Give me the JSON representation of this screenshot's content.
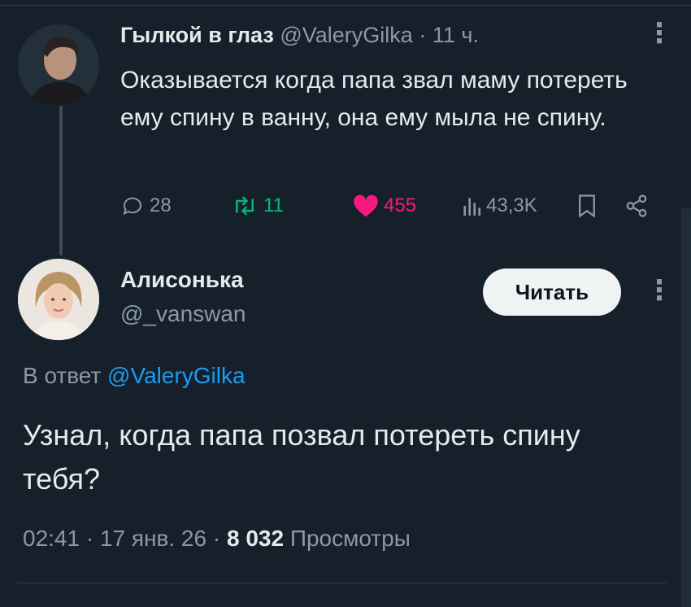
{
  "tweet": {
    "author_name": "Гылкой в глаз",
    "author_handle": "@ValeryGilka",
    "separator": "·",
    "time": "11 ч.",
    "more_icon": "⋮",
    "text": "Оказывается когда папа звал маму потереть ему спину в ванну, она ему мыла не спину.",
    "stats": {
      "replies": "28",
      "retweets": "11",
      "likes": "455",
      "views": "43,3K"
    },
    "icons": [
      "reply-icon",
      "retweet-icon",
      "heart-icon",
      "views-icon",
      "bookmark-icon",
      "share-icon"
    ]
  },
  "reply": {
    "author_name": "Алисонька",
    "author_handle": "@_vanswan",
    "follow_label": "Читать",
    "more_icon": "⋮",
    "reply_to_prefix": "В ответ",
    "reply_to_handle": "@ValeryGilka",
    "text": "Узнал, когда папа позвал потереть спину тебя?",
    "meta_time": "02:41 · 17 янв. 26 ·",
    "meta_views_count": "8 032",
    "meta_views_label": "Просмотры"
  },
  "colors": {
    "background": "#15202b",
    "text_primary": "#e7e9ea",
    "text_secondary": "#8b98a5",
    "link": "#1d9bf0",
    "retweet": "#00ba7c",
    "like": "#f91880"
  }
}
